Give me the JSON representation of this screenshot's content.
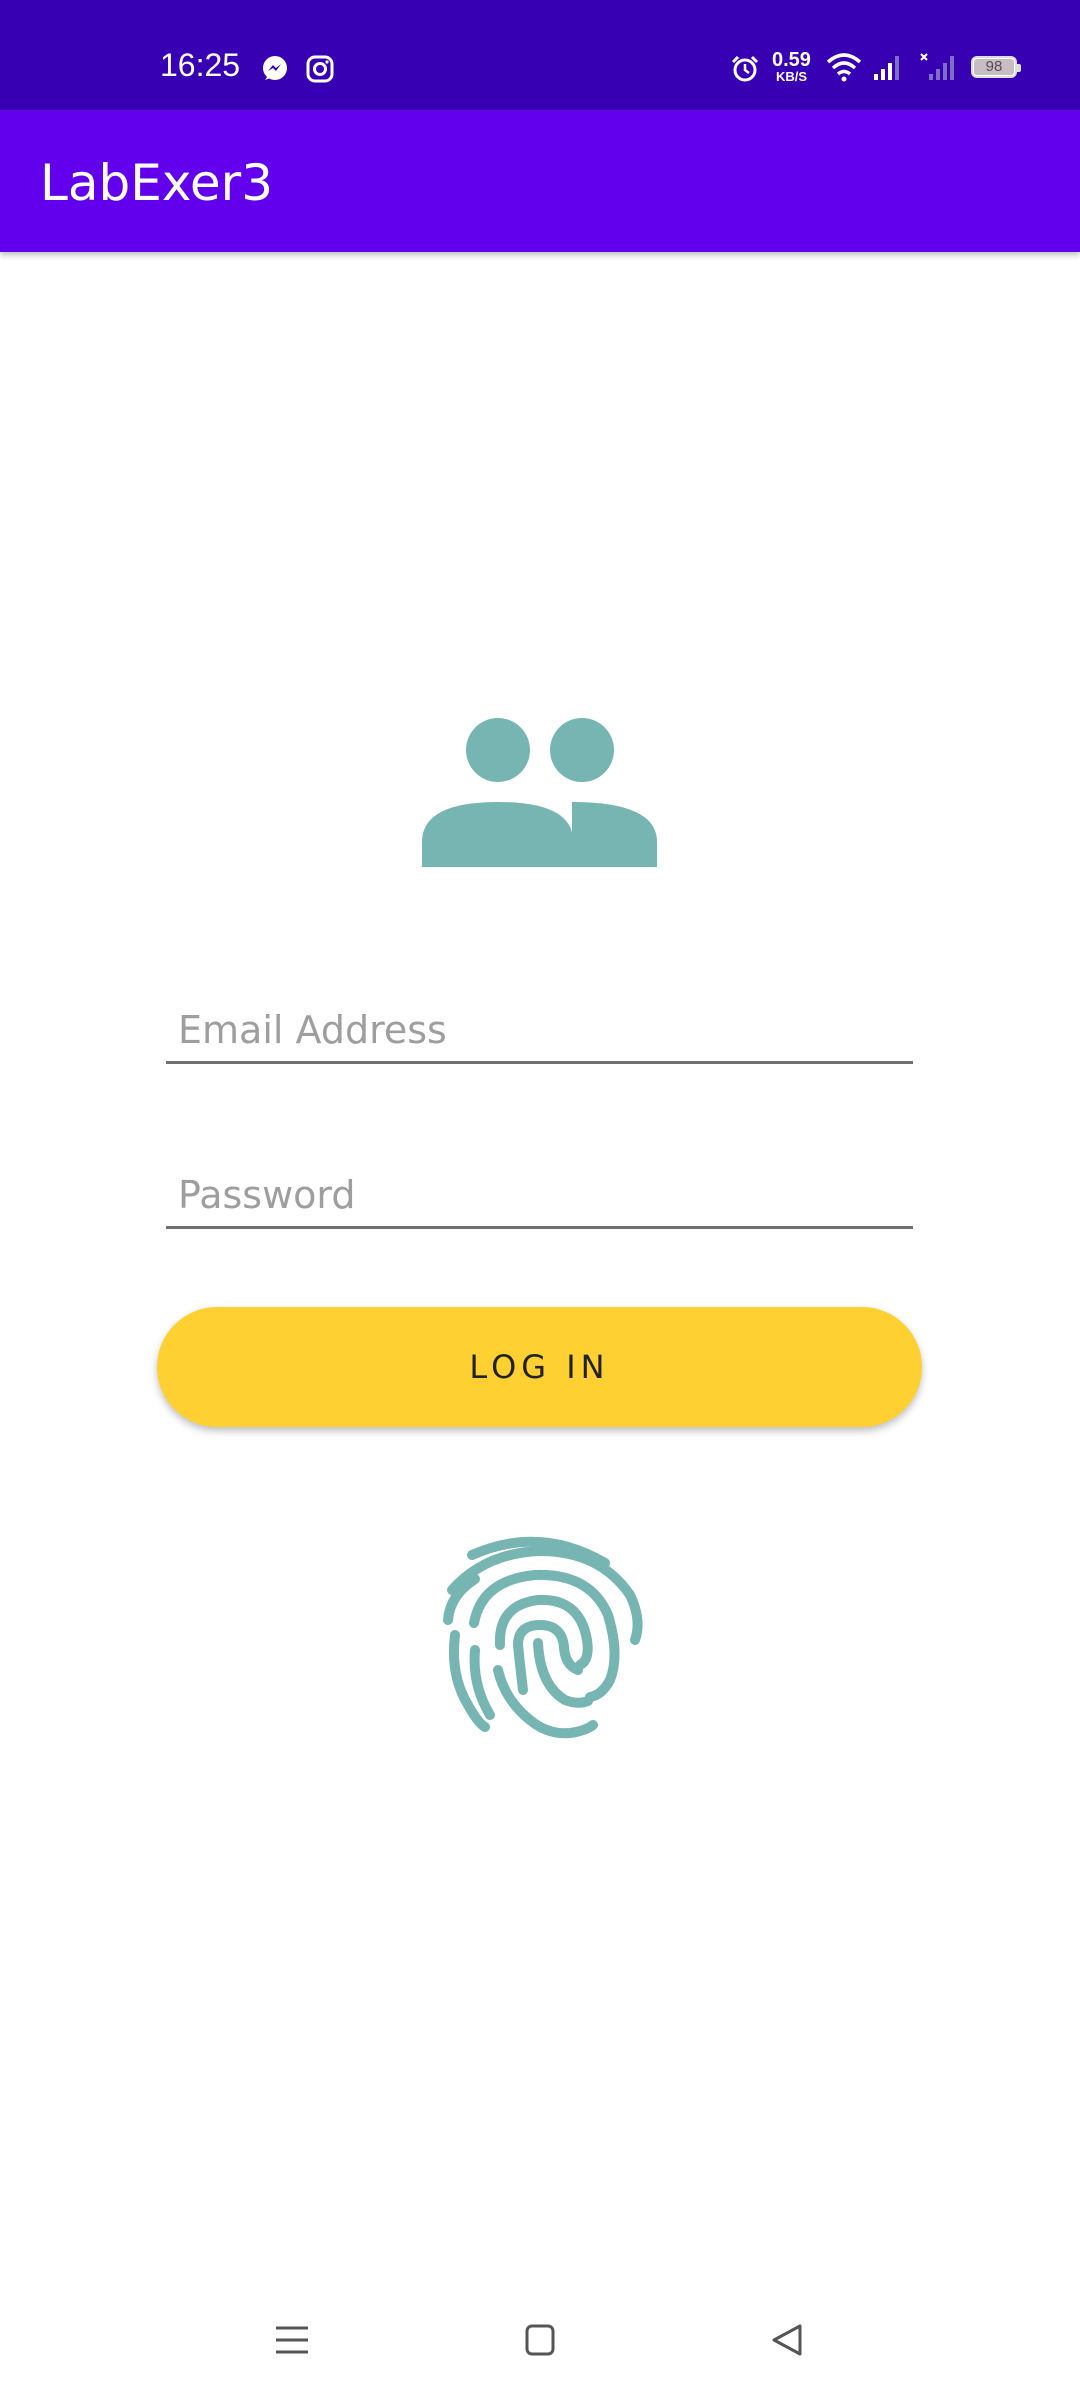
{
  "status_bar": {
    "time": "16:25",
    "notification_icons": [
      "messenger-icon",
      "instagram-icon"
    ],
    "net_speed_value": "0.59",
    "net_speed_unit": "KB/S",
    "battery_level": "98",
    "system_icons": [
      "alarm-icon",
      "wifi-icon",
      "signal-icon",
      "no-signal-icon",
      "battery-icon"
    ]
  },
  "app_bar": {
    "title": "LabExer3"
  },
  "form": {
    "email_placeholder": "Email Address",
    "password_placeholder": "Password",
    "login_label": "LOG IN"
  },
  "icons": {
    "group": "group-icon",
    "fingerprint": "fingerprint-icon"
  },
  "nav_bar": [
    "menu-icon",
    "home-icon",
    "back-icon"
  ],
  "colors": {
    "status_bar": "#3700b3",
    "app_bar": "#6200ee",
    "accent_icon": "#77b5b3",
    "login_button": "#ffd031"
  }
}
